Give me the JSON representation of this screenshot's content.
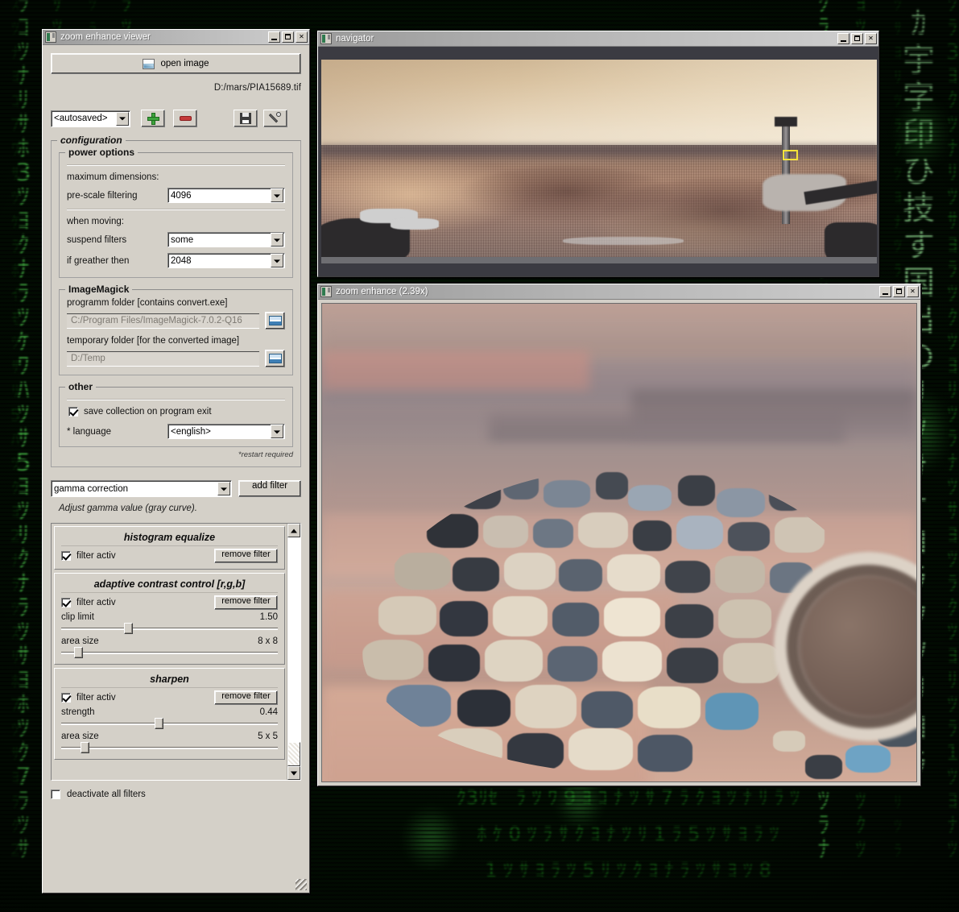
{
  "viewer": {
    "title": "zoom enhance viewer",
    "open_image_label": "open image",
    "file_path": "D:/mars/PIA15689.tif",
    "collection_value": "<autosaved>",
    "config_legend": "configuration",
    "power": {
      "legend": "power options",
      "max_dim_label": "maximum dimensions:",
      "prescale_label": "pre-scale filtering",
      "prescale_value": "4096",
      "when_moving_label": "when moving:",
      "suspend_label": "suspend filters",
      "suspend_value": "some",
      "if_greather_label": "if greather then",
      "if_greather_value": "2048"
    },
    "imagemagick": {
      "legend": "ImageMagick",
      "program_folder_label": "programm folder [contains convert.exe]",
      "program_folder_value": "C:/Program Files/ImageMagick-7.0.2-Q16",
      "temp_folder_label": "temporary folder [for the converted image]",
      "temp_folder_value": "D:/Temp"
    },
    "other": {
      "legend": "other",
      "save_collection_label": "save collection on program exit",
      "save_collection_checked": true,
      "language_label": "* language",
      "language_value": "<english>",
      "restart_note": "*restart required"
    },
    "filter_type_value": "gamma correction",
    "add_filter_label": "add filter",
    "filter_hint": "Adjust gamma value (gray curve).",
    "filters": [
      {
        "name": "histogram equalize",
        "active_label": "filter activ",
        "active": true,
        "remove_label": "remove filter",
        "sliders": []
      },
      {
        "name": "adaptive contrast control [r,g,b]",
        "active_label": "filter activ",
        "active": true,
        "remove_label": "remove filter",
        "sliders": [
          {
            "label": "clip limit",
            "value": "1.50",
            "pos": 29
          },
          {
            "label": "area size",
            "value": "8 x 8",
            "pos": 6
          }
        ]
      },
      {
        "name": "sharpen",
        "active_label": "filter activ",
        "active": true,
        "remove_label": "remove filter",
        "sliders": [
          {
            "label": "strength",
            "value": "0.44",
            "pos": 43
          },
          {
            "label": "area size",
            "value": "5 x 5",
            "pos": 9
          }
        ]
      }
    ],
    "deactivate_all_label": "deactivate all filters",
    "deactivate_all_checked": false
  },
  "navigator": {
    "title": "navigator"
  },
  "zoomwin": {
    "title": "zoom enhance (2.39x)",
    "zoom_factor": "2.39x"
  },
  "colors": {
    "window_face": "#d4d0c8",
    "title_active": "#b5b5b5",
    "selection_rect": "#f4e23a",
    "matrix_green": "#1c8a1c",
    "nav_backdrop": "#3b3b42"
  },
  "matrix_chars": [
    "ﾒｶﾘ8ｻ2ﾂ",
    "ｸ3ﾖ1ﾜﾅ",
    "ﾂ7ｸﾗ5ﾊ",
    "ﾘ宇ﾖ2ﾂ",
    "ｹ字印ﾊ",
    "ﾜひ技ｺ",
    "ﾅす国出",
    "ﾖのﾂ9"
  ]
}
